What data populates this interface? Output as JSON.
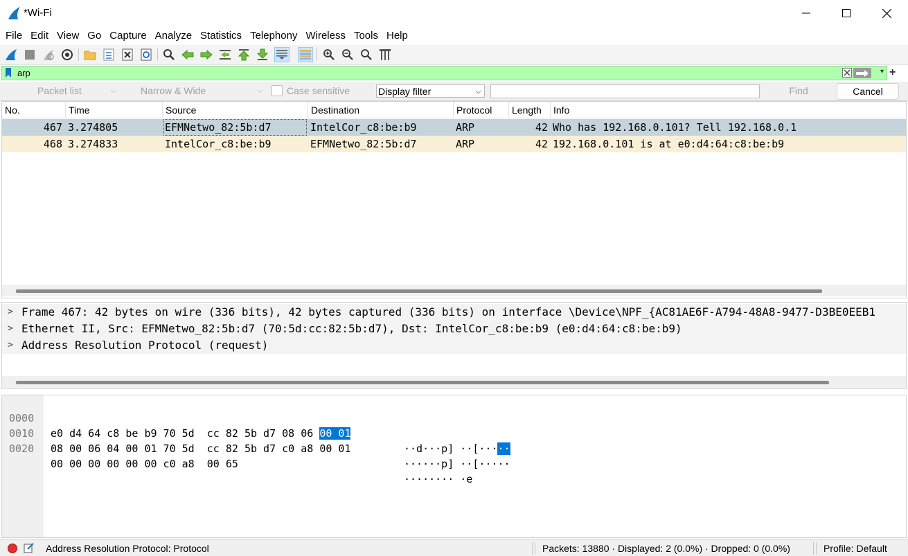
{
  "window": {
    "title": "*Wi-Fi"
  },
  "menu": [
    "File",
    "Edit",
    "View",
    "Go",
    "Capture",
    "Analyze",
    "Statistics",
    "Telephony",
    "Wireless",
    "Tools",
    "Help"
  ],
  "filter": {
    "value": "arp",
    "background_color": "#afffaf"
  },
  "find_bar": {
    "search_in": "Packet list",
    "char_width": "Narrow & Wide",
    "case_sensitive_label": "Case sensitive",
    "search_type": "Display filter",
    "find_label": "Find",
    "cancel_label": "Cancel"
  },
  "packet_list": {
    "columns": [
      "No.",
      "Time",
      "Source",
      "Destination",
      "Protocol",
      "Length",
      "Info"
    ],
    "rows": [
      {
        "no": "467",
        "time": "3.274805",
        "source": "EFMNetwo_82:5b:d7",
        "destination": "IntelCor_c8:be:b9",
        "protocol": "ARP",
        "length": "42",
        "info": "Who has 192.168.0.101? Tell 192.168.0.1"
      },
      {
        "no": "468",
        "time": "3.274833",
        "source": "IntelCor_c8:be:b9",
        "destination": "EFMNetwo_82:5b:d7",
        "protocol": "ARP",
        "length": "42",
        "info": "192.168.0.101 is at e0:d4:64:c8:be:b9"
      }
    ]
  },
  "details": [
    "Frame 467: 42 bytes on wire (336 bits), 42 bytes captured (336 bits) on interface \\Device\\NPF_{AC81AE6F-A794-48A8-9477-D3BE0EEB1",
    "Ethernet II, Src: EFMNetwo_82:5b:d7 (70:5d:cc:82:5b:d7), Dst: IntelCor_c8:be:b9 (e0:d4:64:c8:be:b9)",
    "Address Resolution Protocol (request)"
  ],
  "bytes": [
    {
      "offset": "0000",
      "hex_a": "e0 d4 64 c8 be b9 70 5d  cc 82 5b d7 08 06 ",
      "hex_hl": "00 01",
      "ascii_a": "··d···p] ··[···",
      "ascii_hl": "··"
    },
    {
      "offset": "0010",
      "hex_a": "08 00 06 04 00 01 70 5d  cc 82 5b d7 c0 a8 00 01",
      "hex_hl": "",
      "ascii_a": "······p] ··[·····",
      "ascii_hl": ""
    },
    {
      "offset": "0020",
      "hex_a": "00 00 00 00 00 00 c0 a8  00 65",
      "hex_hl": "",
      "ascii_a": "········ ·e",
      "ascii_hl": ""
    }
  ],
  "status": {
    "field_info": "Address Resolution Protocol: Protocol",
    "counts": "Packets: 13880 · Displayed: 2 (0.0%) · Dropped: 0 (0.0%)",
    "profile": "Profile: Default"
  },
  "colors": {
    "selected_row": "#c4d4da",
    "arp_row": "#faf0d7",
    "byte_highlight": "#0078d7"
  }
}
